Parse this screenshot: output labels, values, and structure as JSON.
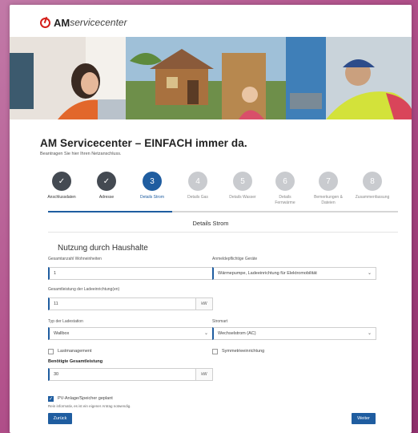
{
  "header": {
    "logo_am": "AM",
    "logo_rest": "servicecenter",
    "title": "AM Servicecenter – EINFACH immer da.",
    "subtitle": "Beantragen Sie hier Ihren Netzanschluss."
  },
  "stepper": {
    "active_index": 2,
    "steps": [
      {
        "number": "✓",
        "label": "Anschlussdaten",
        "state": "done"
      },
      {
        "number": "✓",
        "label": "Adresse",
        "state": "done"
      },
      {
        "number": "3",
        "label": "Details Strom",
        "state": "active"
      },
      {
        "number": "4",
        "label": "Details Gas",
        "state": "todo"
      },
      {
        "number": "5",
        "label": "Details Wasser",
        "state": "todo"
      },
      {
        "number": "6",
        "label": "Details Fernwärme",
        "state": "todo"
      },
      {
        "number": "7",
        "label": "Bemerkungen & Dateien",
        "state": "todo"
      },
      {
        "number": "8",
        "label": "Zusammenfassung",
        "state": "todo"
      }
    ]
  },
  "section": {
    "heading": "Details Strom"
  },
  "form": {
    "title": "Nutzung durch Haushalte",
    "wohneinheiten": {
      "label": "Gesamtanzahl Wohneinheiten",
      "value": "1"
    },
    "geraete": {
      "label": "Anmeldepflichtige Geräte",
      "value": "Wärmepumpe, Ladeeinrichtung für Elektromobilität"
    },
    "ladeleistung": {
      "label": "Gesamtleistung der Ladeeinrichtung(en)",
      "value": "11",
      "unit": "kW"
    },
    "ladestation": {
      "label": "Typ der Ladestation",
      "value": "Wallbox"
    },
    "stromart": {
      "label": "Stromart",
      "value": "Wechselstrom (AC)"
    },
    "lastmanagement": {
      "label": "Lastmanagement",
      "checked": false
    },
    "symmetrie": {
      "label": "Symmetrieeinrichtung",
      "checked": false
    },
    "gesamtleistung": {
      "label": "Benötigte Gesamtleistung",
      "value": "30",
      "unit": "kW"
    },
    "pv": {
      "label": "PV-Anlage/Speicher geplant",
      "checked": true,
      "hint": "Rein informativ, es ist ein eigener Antrag notwendig."
    }
  },
  "buttons": {
    "back": "Zurück",
    "next": "Weiter"
  },
  "icons": {
    "check": "check-icon",
    "chevron": "chevron-down-icon",
    "logo": "am-logo-icon"
  },
  "colors": {
    "primary": "#1f5da0",
    "done": "#444a52",
    "todo": "#c9cbcf",
    "brand_red": "#d5201b"
  }
}
